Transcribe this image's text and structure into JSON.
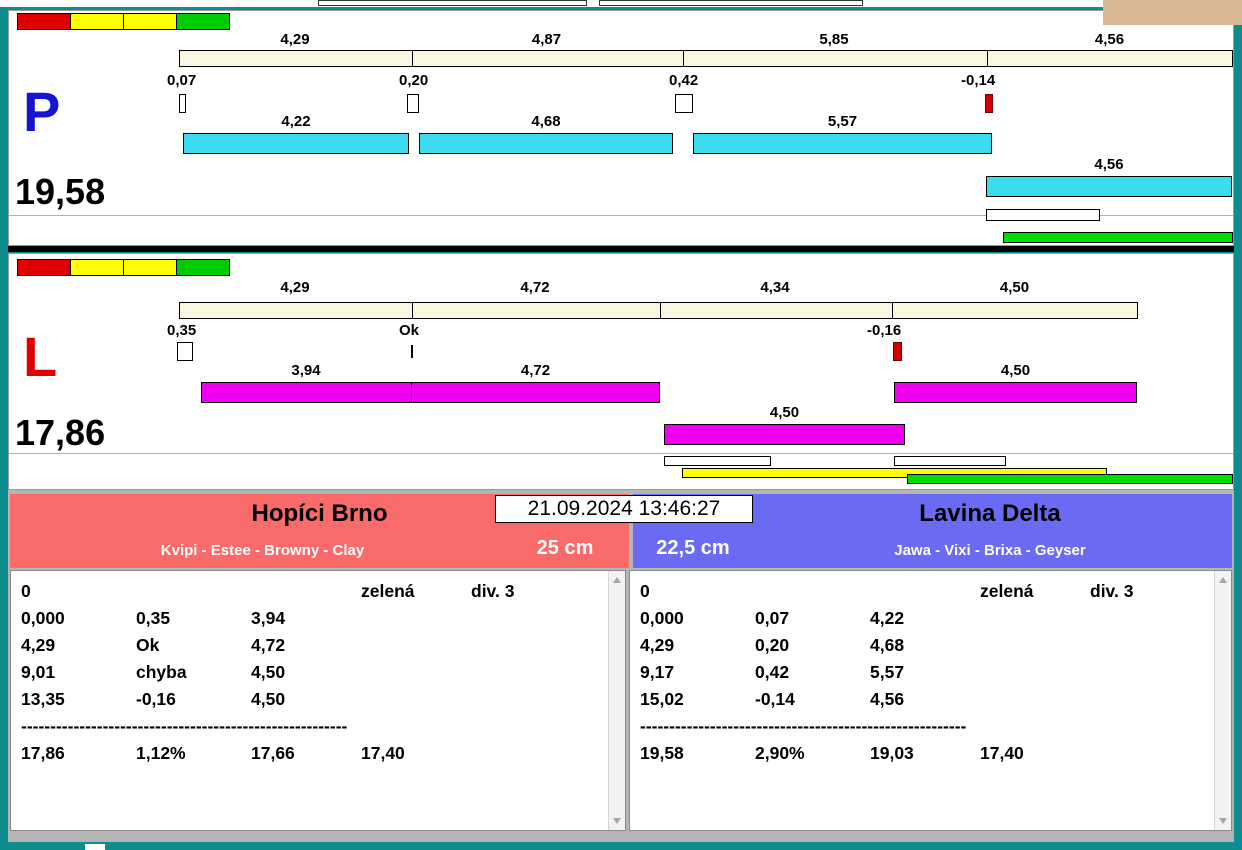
{
  "datetime": "21.09.2024 13:46:27",
  "colors": {
    "window_border": "#0d8d8d",
    "legend_red": "#e00000",
    "legend_yellow": "#ffff00",
    "legend_green": "#00cc00",
    "scale_bar": "#f8f8e1",
    "lane_p_bar": "#3cdcef",
    "lane_l_bar": "#ee00ee",
    "negative_marker": "#d40000",
    "yellow_bar": "#ffff00",
    "green_bar": "#00dd00",
    "team_left_header": "#f96a6a",
    "team_right_header": "#6a6af2",
    "lane_p_letter": "#1515d2",
    "lane_l_letter": "#e00000"
  },
  "panel_p": {
    "letter": "P",
    "total": "19,58",
    "scale_segments": [
      "4,29",
      "4,87",
      "5,85",
      "4,56"
    ],
    "deviations": [
      "0,07",
      "0,20",
      "0,42",
      "-0,14"
    ],
    "bars": [
      "4,22",
      "4,68",
      "5,57"
    ],
    "extra_bar": "4,56"
  },
  "panel_l": {
    "letter": "L",
    "total": "17,86",
    "scale_segments": [
      "4,29",
      "4,72",
      "4,34",
      "4,50"
    ],
    "deviations": [
      "0,35",
      "Ok",
      "-0,16"
    ],
    "bars": [
      "3,94",
      "4,72",
      "4,50"
    ],
    "extra_bar": "4,50"
  },
  "team_left": {
    "name": "Hopíci Brno",
    "members": "Kvipi - Estee - Browny - Clay",
    "width_label": "25 cm",
    "info_row": {
      "c1": "0",
      "c4": "zelená",
      "c5": "div. 3"
    },
    "rows": [
      {
        "c1": "0,000",
        "c2": "0,35",
        "c3": "3,94"
      },
      {
        "c1": "4,29",
        "c2": "Ok",
        "c3": "4,72"
      },
      {
        "c1": "9,01",
        "c2": "chyba",
        "c3": "4,50"
      },
      {
        "c1": "13,35",
        "c2": "-0,16",
        "c3": "4,50"
      }
    ],
    "separator": "--------------------------------------------------------",
    "totals": {
      "c1": "17,86",
      "c2": "1,12%",
      "c3": "17,66",
      "c4": "17,40"
    }
  },
  "team_right": {
    "name": "Lavina Delta",
    "members": "Jawa - Vixi - Brixa - Geyser",
    "width_label": "22,5 cm",
    "info_row": {
      "c1": "0",
      "c4": "zelená",
      "c5": "div. 3"
    },
    "rows": [
      {
        "c1": "0,000",
        "c2": "0,07",
        "c3": "4,22"
      },
      {
        "c1": "4,29",
        "c2": "0,20",
        "c3": "4,68"
      },
      {
        "c1": "9,17",
        "c2": "0,42",
        "c3": "5,57"
      },
      {
        "c1": "15,02",
        "c2": "-0,14",
        "c3": "4,56"
      }
    ],
    "separator": "--------------------------------------------------------",
    "totals": {
      "c1": "19,58",
      "c2": "2,90%",
      "c3": "19,03",
      "c4": "17,40"
    }
  }
}
